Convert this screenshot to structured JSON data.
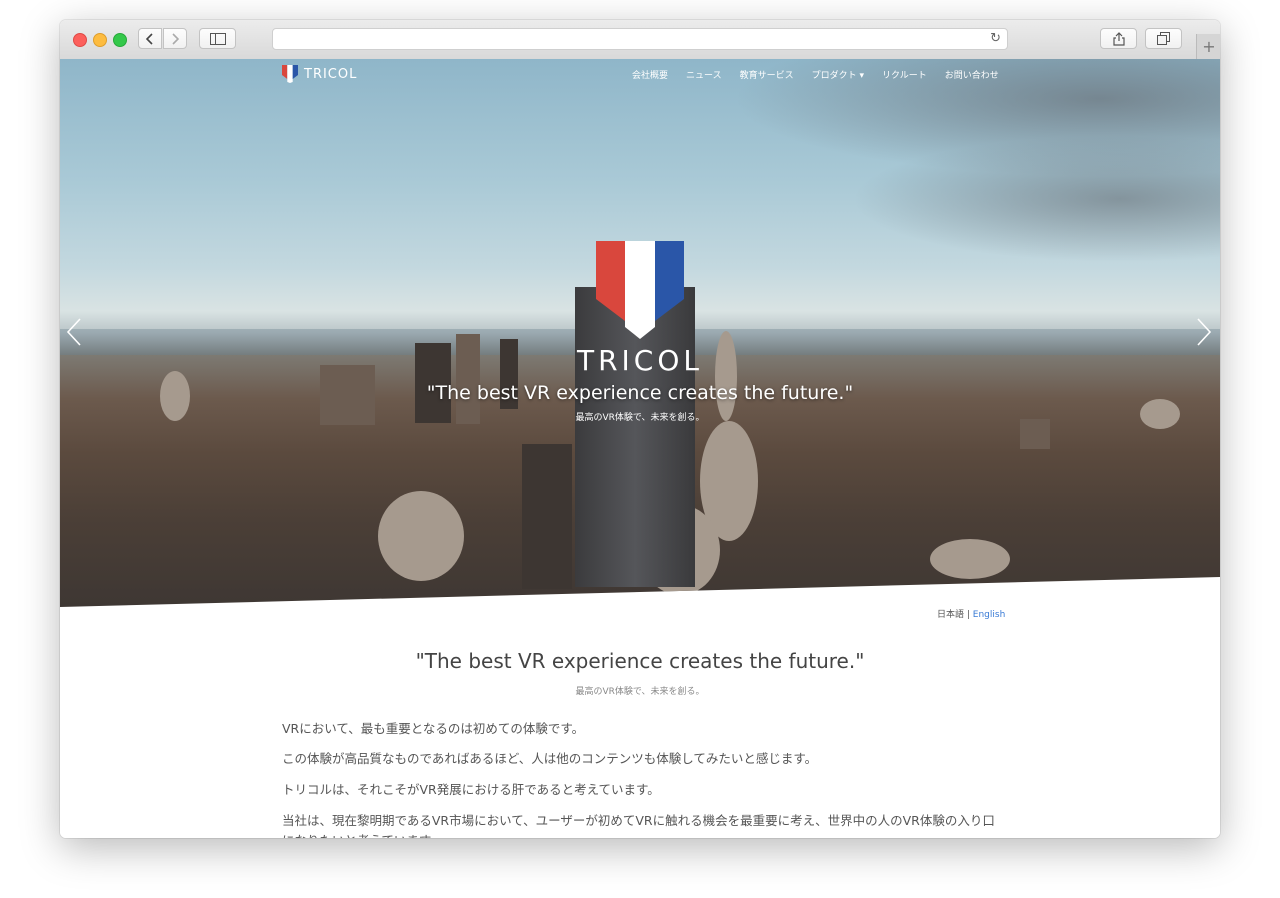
{
  "site": {
    "logo_text": "TRICOL",
    "nav": [
      "会社概要",
      "ニュース",
      "教育サービス",
      "プロダクト ▾",
      "リクルート",
      "お問い合わせ"
    ]
  },
  "hero": {
    "brand": "TRICOL",
    "quote": "\"The best VR experience creates the future.\"",
    "sub": "最高のVR体験で、未来を創る。"
  },
  "lang": {
    "ja": "日本語",
    "sep": " | ",
    "en": "English"
  },
  "content": {
    "title": "\"The best VR experience creates the future.\"",
    "sub": "最高のVR体験で、未来を創る。",
    "paragraphs": [
      "VRにおいて、最も重要となるのは初めての体験です。",
      "この体験が高品質なものであればあるほど、人は他のコンテンツも体験してみたいと感じます。",
      "トリコルは、それこそがVR発展における肝であると考えています。",
      "当社は、現在黎明期であるVR市場において、ユーザーが初めてVRに触れる機会を最重要に考え、世界中の人のVR体験の入り口になりたいと考えています。"
    ]
  },
  "colors": {
    "flag_red": "#d9473d",
    "flag_white": "#ffffff",
    "flag_blue": "#2a56a8",
    "link": "#3a7bd5"
  }
}
